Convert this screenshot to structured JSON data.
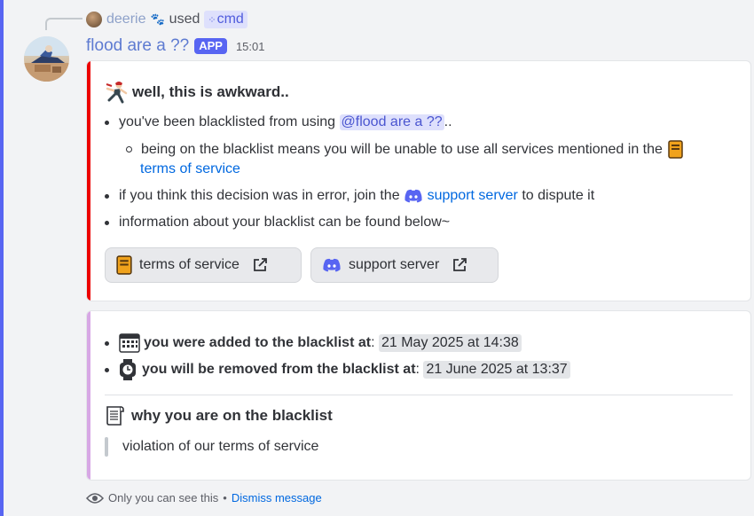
{
  "reply": {
    "user": "deerie",
    "paw": "🐾",
    "action": "used",
    "command": "cmd"
  },
  "message": {
    "author": "flood are a ??",
    "badge": "APP",
    "time": "15:01"
  },
  "embed1": {
    "title": "well, this is awkward..",
    "line1_prefix": "you've been blacklisted from using",
    "line1_mention": "@flood are a ??",
    "line1_suffix": "..",
    "sub_line_text": "being on the blacklist means you will be unable to use all services mentioned in the",
    "sub_line_link": "terms of service",
    "line2_prefix": "if you think this decision was in error, join the",
    "line2_link": "support server",
    "line2_suffix": "to dispute it",
    "line3": "information about your blacklist can be found below~",
    "buttons": [
      {
        "label": "terms of service"
      },
      {
        "label": "support server"
      }
    ]
  },
  "embed2": {
    "added_label": "you were added to the blacklist at",
    "added_colon": ":",
    "added_time": "21 May 2025 at 14:38",
    "removed_label": "you will be removed from the blacklist at",
    "removed_colon": ":",
    "removed_time": "21 June 2025 at 13:37",
    "reason_title": "why you are on the blacklist",
    "reason_text": "violation of our terms of service"
  },
  "footer": {
    "note": "Only you can see this",
    "sep": "•",
    "dismiss": "Dismiss message"
  },
  "colors": {
    "accent": "#5865f2",
    "embed1_bar": "#ed0000",
    "embed2_bar": "#d7a7e5",
    "link": "#0068e0"
  }
}
